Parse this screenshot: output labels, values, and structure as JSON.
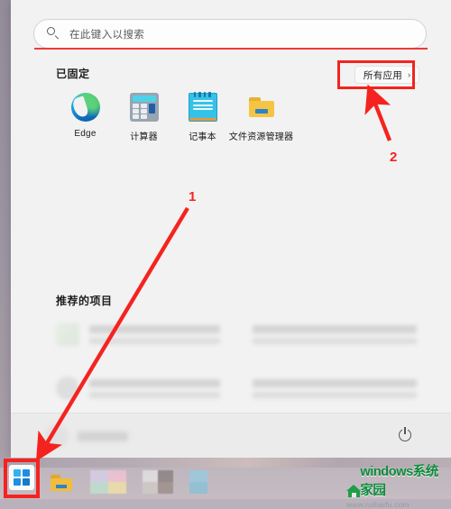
{
  "window": {
    "name": "windows-11-start-menu",
    "os": "Windows 11"
  },
  "search": {
    "placeholder": "在此键入以搜索",
    "value": "",
    "icon": "search-icon"
  },
  "pinned": {
    "header": "已固定",
    "all_apps_label": "所有应用",
    "all_apps_chevron": "›",
    "apps": [
      {
        "label": "Edge",
        "icon": "edge-icon"
      },
      {
        "label": "计算器",
        "icon": "calculator-icon"
      },
      {
        "label": "记事本",
        "icon": "notepad-icon"
      },
      {
        "label": "文件资源管理器",
        "icon": "file-explorer-icon"
      }
    ]
  },
  "recommended": {
    "header": "推荐的项目",
    "items": [
      {
        "title": "",
        "subtitle": "",
        "thumb": "blurred-thumb"
      },
      {
        "title": "",
        "subtitle": "",
        "thumb": "blurred-thumb"
      },
      {
        "title": "",
        "subtitle": "",
        "thumb": "blurred-thumb"
      },
      {
        "title": "",
        "subtitle": "",
        "thumb": "blurred-thumb"
      }
    ]
  },
  "bottom_bar": {
    "user_name": "",
    "avatar": "user-avatar",
    "power_icon": "power-icon"
  },
  "taskbar": {
    "start_button": "start-button",
    "items": [
      {
        "icon": "file-explorer-icon"
      },
      {
        "icon": "app-icon-multicolor"
      },
      {
        "icon": "app-icon-gray"
      },
      {
        "icon": "app-icon-blue"
      }
    ]
  },
  "annotations": {
    "color": "#f5231f",
    "marks": [
      {
        "number": "1",
        "target": "start-button",
        "type": "arrow"
      },
      {
        "number": "2",
        "target": "all-apps-button",
        "type": "arrow"
      }
    ],
    "highlight_boxes": [
      {
        "target": "all-apps-button"
      },
      {
        "target": "start-button"
      }
    ]
  },
  "watermark": {
    "title": "windows系统家园",
    "url": "www.ruihaifu.com",
    "color": "#0e8a3c"
  }
}
